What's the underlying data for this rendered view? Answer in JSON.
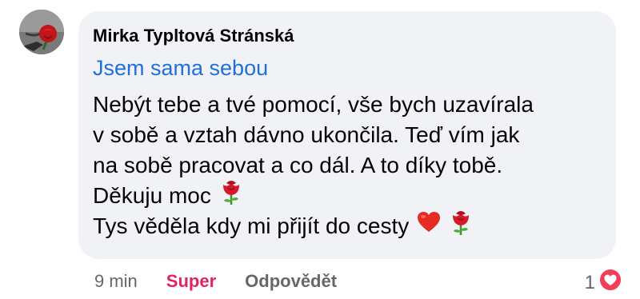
{
  "comment": {
    "author": "Mirka Typltová Stránská",
    "badge": "Jsem sama sebou",
    "lines": [
      "Nebýt tebe a tvé pomocí, vše bych uzavírala",
      "v sobě a vztah dávno ukončila. Teď vím jak",
      "na sobě pracovat a co dál. A to díky tobě.",
      "Děkuju moc",
      "Tys věděla kdy mi přijít do cesty"
    ],
    "line_emojis": [
      [],
      [],
      [],
      [
        "rose-icon"
      ],
      [
        "heart-icon",
        "rose-icon"
      ]
    ]
  },
  "actions": {
    "time": "9 min",
    "like_label": "Super",
    "reply_label": "Odpovědět"
  },
  "reactions": {
    "count": "1",
    "icon": "love-reaction-icon"
  },
  "colors": {
    "bubble": "#f0f2f5",
    "badge": "#216fdb",
    "like": "#e0245e",
    "muted": "#65676b",
    "text": "#050505"
  }
}
